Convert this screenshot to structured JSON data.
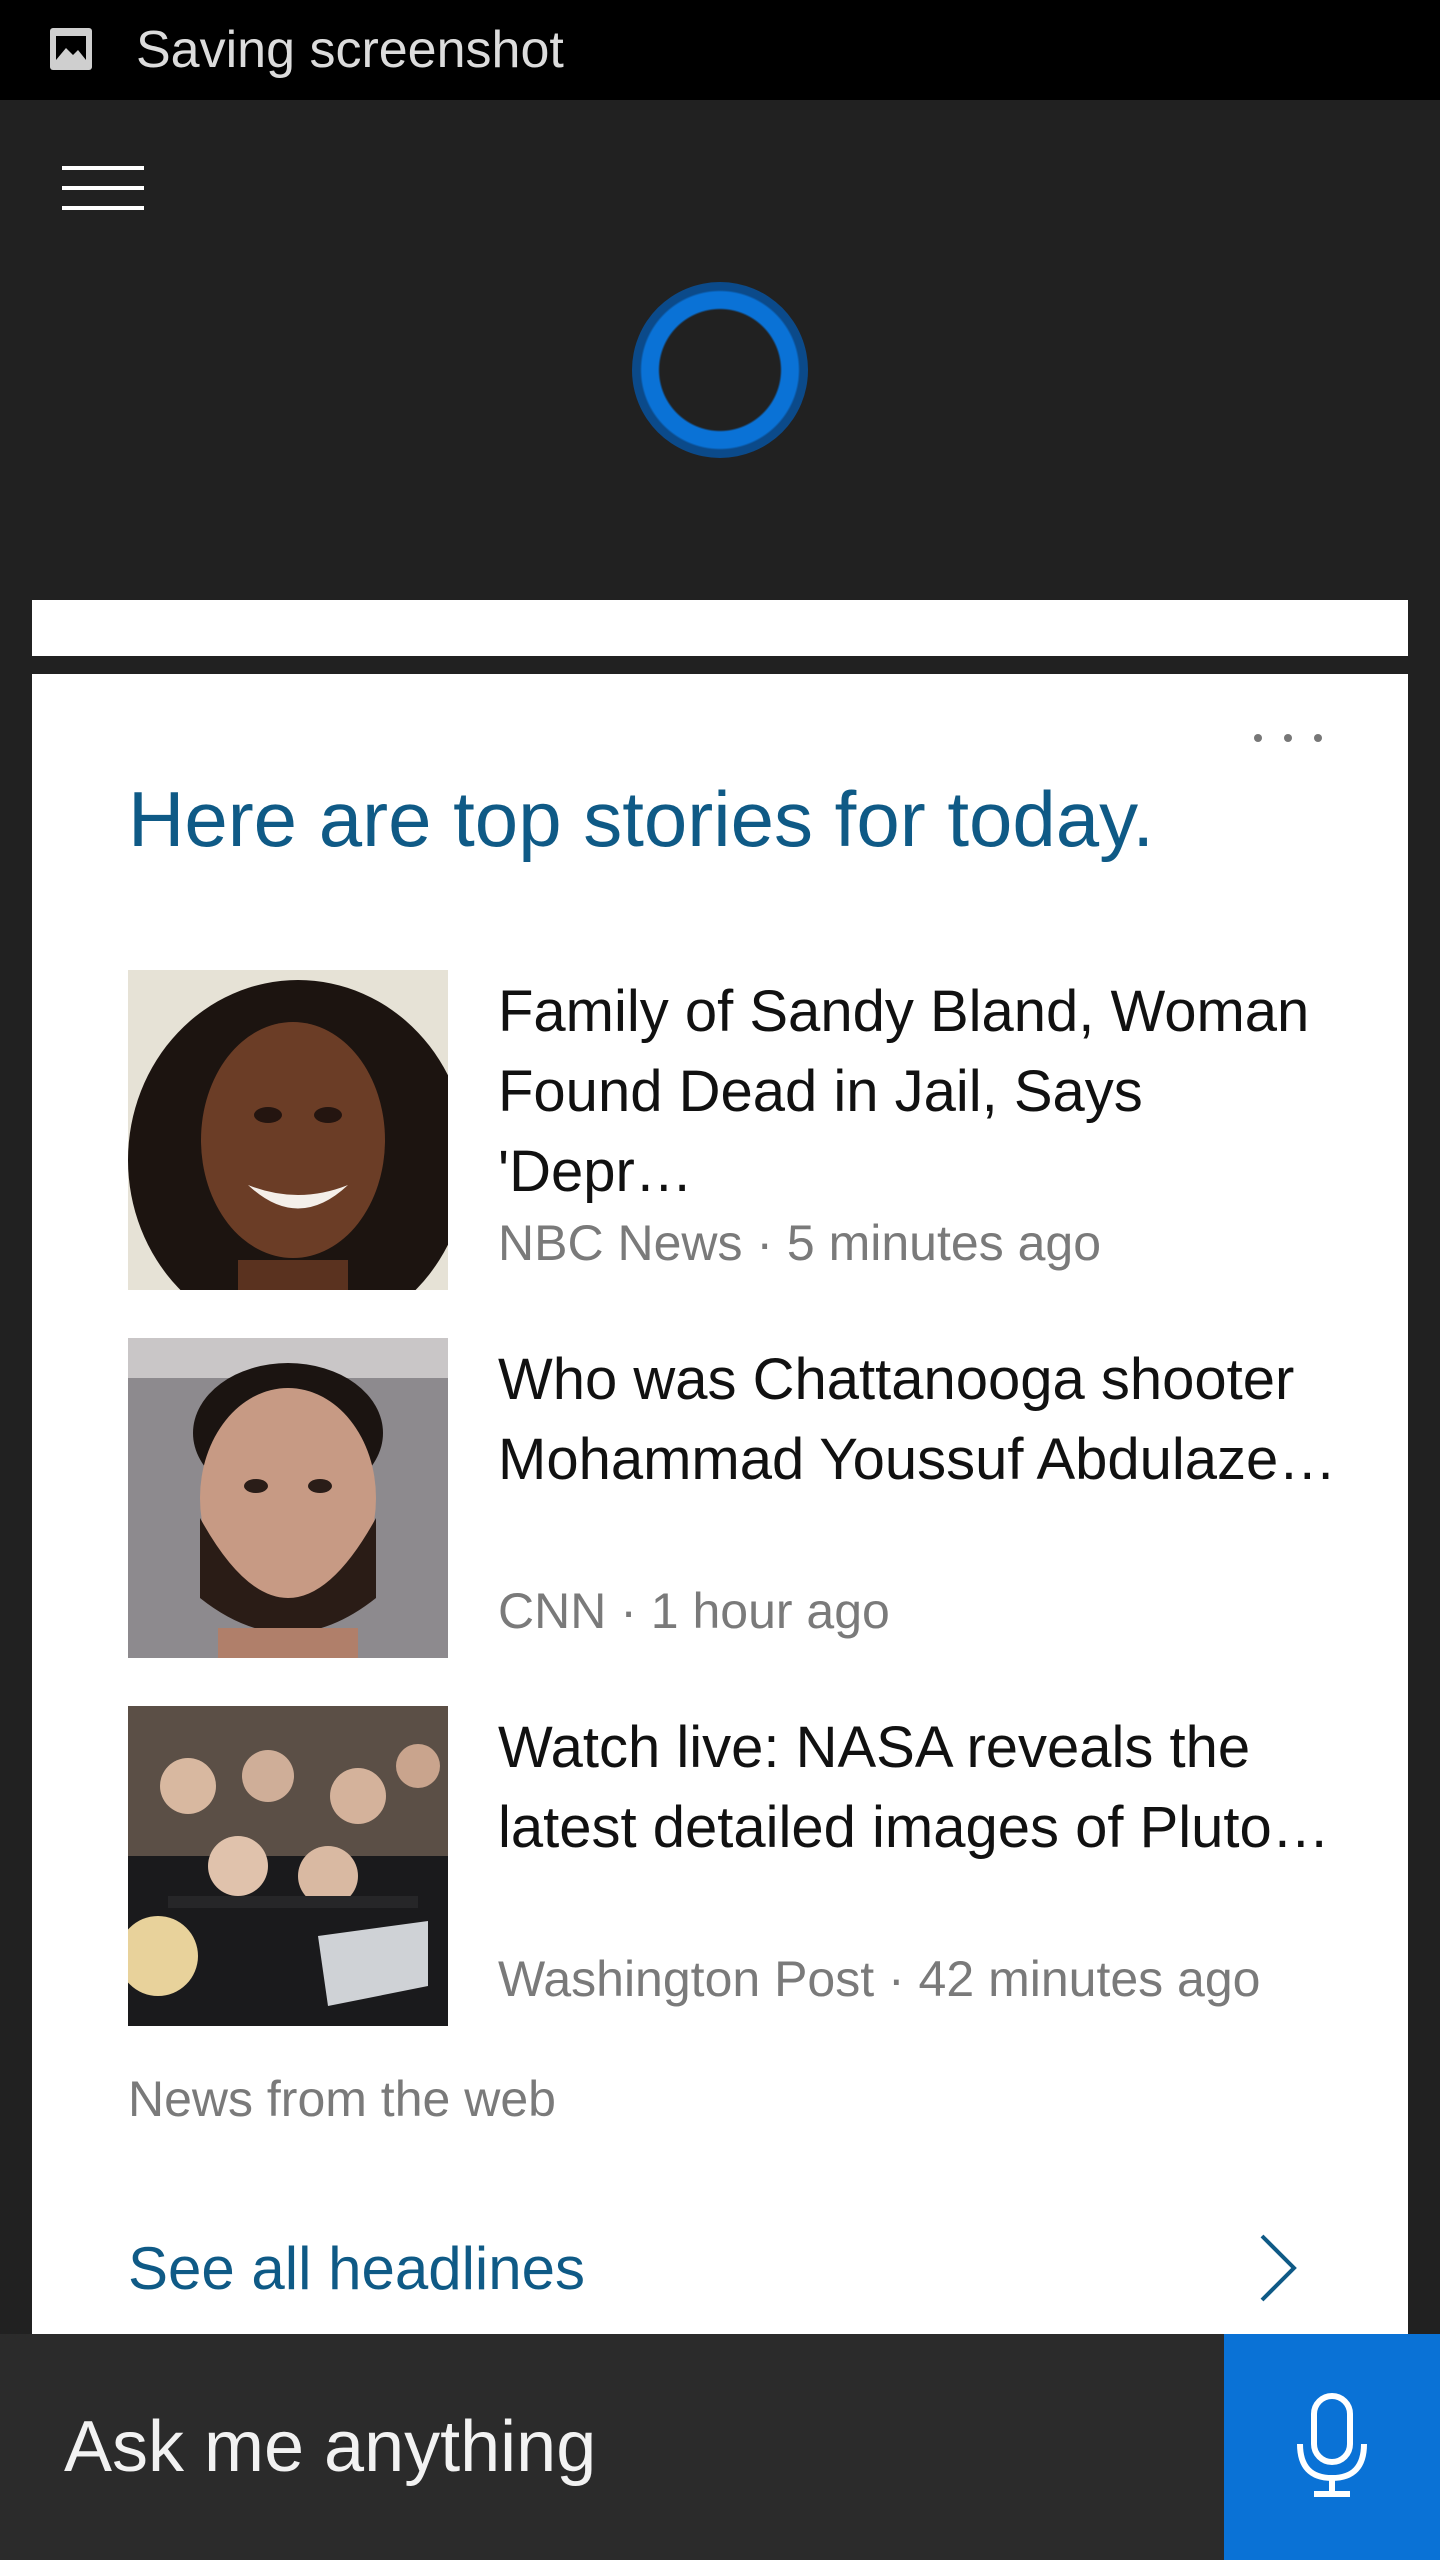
{
  "status_bar": {
    "icon": "image-icon",
    "text": "Saving screenshot"
  },
  "header": {
    "menu_icon": "hamburger-menu-icon",
    "logo_icon": "cortana-ring-icon"
  },
  "card": {
    "more_icon": "more-dots-icon",
    "title": "Here are top stories for today.",
    "stories": [
      {
        "headline": "Family of Sandy Bland, Woman Found Dead in Jail, Says 'Depr…",
        "meta": "NBC News · 5 minutes ago"
      },
      {
        "headline": "Who was Chattanooga shooter Mohammad Youssuf Abdulaze…",
        "meta": "CNN · 1 hour ago"
      },
      {
        "headline": "Watch live: NASA reveals the latest detailed images of Pluto…",
        "meta": "Washington Post · 42 minutes ago"
      }
    ],
    "source_note": "News from the web",
    "see_all": "See all headlines",
    "see_all_icon": "chevron-right-icon"
  },
  "bottom_bar": {
    "placeholder": "Ask me anything",
    "mic_icon": "microphone-icon"
  },
  "colors": {
    "accent": "#0a72d6",
    "title": "#0f5a86",
    "background": "#212121"
  }
}
